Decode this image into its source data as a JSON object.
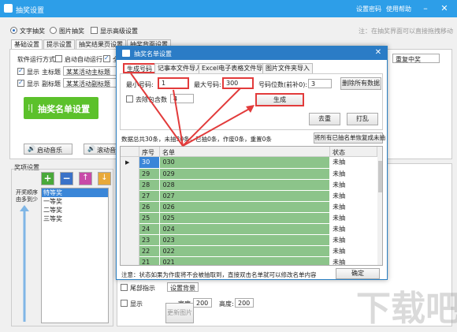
{
  "main": {
    "title": "抽奖设置",
    "links": {
      "settings": "设置密码",
      "help": "使用帮助"
    },
    "modes": {
      "text": "文字抽奖",
      "image": "图片抽奖",
      "advanced": "显示高级设置"
    },
    "note": "注：在抽奖界面可以直接拖拽移动",
    "tabs": [
      "基础设置",
      "提示设置",
      "抽奖结果页设置",
      "抽奖背面设置"
    ],
    "run_mode_label": "软件运行方式",
    "auto_run": "启动自动运行",
    "full": "全屏",
    "show": "显示",
    "main_title_label": "主标题",
    "main_title_value": "某某活动主标题",
    "sub_title_label": "副标题",
    "sub_title_value": "某某活动副标题",
    "repeat_select": "重复中奖",
    "big_button": "抽奖名单设置",
    "start_music": "启动音乐",
    "roll_music": "滚动音乐",
    "prize_section": "奖项设置",
    "prize_side_label": "开奖顺序\n由多到少",
    "prize_list": [
      "特等奖",
      "一等奖",
      "二等奖",
      "三等奖"
    ],
    "width_label": "宽度:",
    "width_value": "200",
    "height_label": "高度:",
    "height_value": "200",
    "show2": "显示",
    "image_select": "设置背景",
    "bottom_btn": "更新图片",
    "partial_label": "尾部指示"
  },
  "dialog": {
    "title": "抽奖名单设置",
    "tabs": [
      "生成号码",
      "记事本文件导入",
      "Excel电子表格文件导入",
      "图片文件夹导入"
    ],
    "min_label": "最小号码:",
    "min_value": "1",
    "max_label": "最大号码:",
    "max_value": "300",
    "digits_label": "号码位数(前补0):",
    "digits_value": "3",
    "delete_all": "删除所有数据",
    "exclude_label": "去除包含数",
    "exclude_value": "4",
    "generate": "生成",
    "dedupe": "去重",
    "shuffle": "打乱",
    "summary": "数据总共30条，未抽30条，已抽0条，作废0条，重置0条",
    "reset_btn": "将所有已抽名单恢复成未抽",
    "columns": [
      "序号",
      "名单",
      "状态"
    ],
    "rows": [
      {
        "no": "30",
        "name": "030",
        "status": "未抽"
      },
      {
        "no": "29",
        "name": "029",
        "status": "未抽"
      },
      {
        "no": "28",
        "name": "028",
        "status": "未抽"
      },
      {
        "no": "27",
        "name": "027",
        "status": "未抽"
      },
      {
        "no": "26",
        "name": "026",
        "status": "未抽"
      },
      {
        "no": "25",
        "name": "025",
        "status": "未抽"
      },
      {
        "no": "24",
        "name": "024",
        "status": "未抽"
      },
      {
        "no": "23",
        "name": "023",
        "status": "未抽"
      },
      {
        "no": "22",
        "name": "022",
        "status": "未抽"
      },
      {
        "no": "21",
        "name": "021",
        "status": "未抽"
      }
    ],
    "footer_note": "注意：状态如果为作废将不会被抽取到，直接双击名单就可以修改名单内容",
    "ok": "确定"
  },
  "colors": {
    "titlebar": "#2d9ee8",
    "dialog_titlebar": "#2b7cc6",
    "green_button": "#5cc12b",
    "table_green": "#8cc48a",
    "highlight": "#e23b3b"
  },
  "watermark": "下载吧"
}
